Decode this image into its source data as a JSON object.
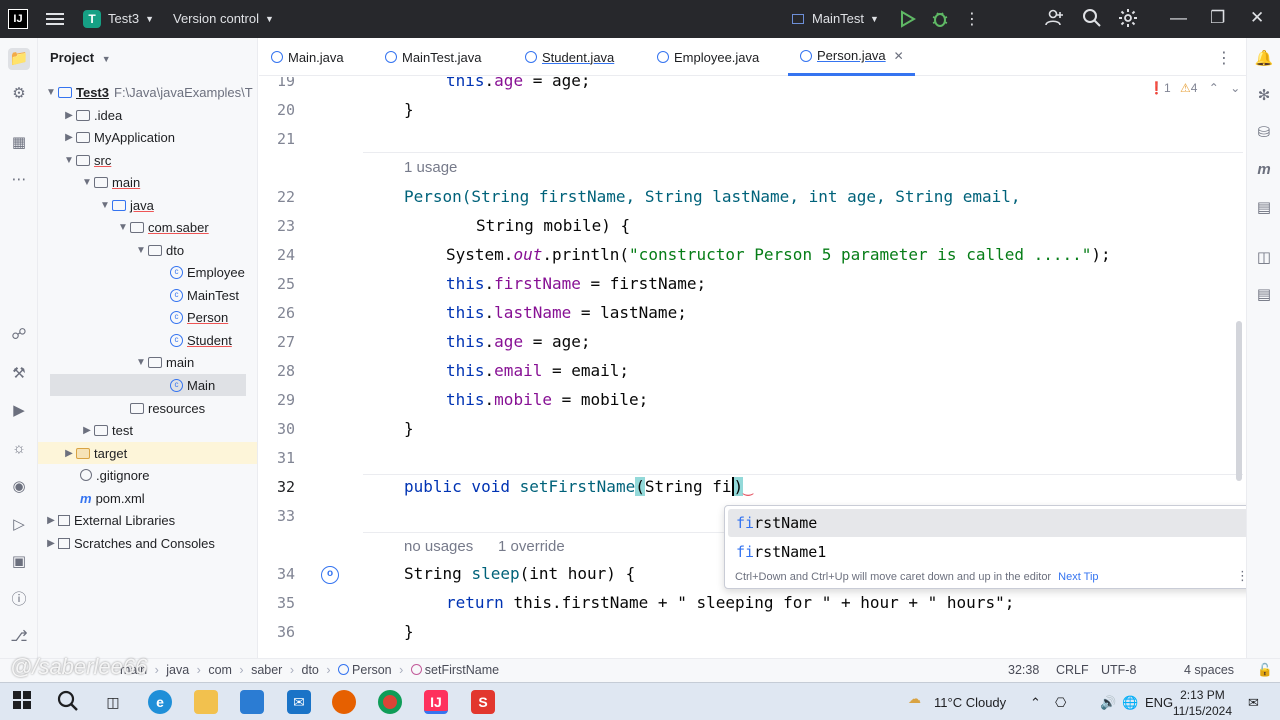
{
  "titlebar": {
    "project_badge": "T",
    "project_name": "Test3",
    "version_control": "Version control",
    "run_config": "MainTest"
  },
  "project_panel": {
    "title": "Project",
    "tree": [
      {
        "label": "Test3",
        "path": "F:\\Java\\javaExamples\\T",
        "type": "module"
      },
      {
        "label": ".idea",
        "type": "folder"
      },
      {
        "label": "MyApplication",
        "type": "folder"
      },
      {
        "label": "src",
        "type": "folder"
      },
      {
        "label": "main",
        "type": "folder"
      },
      {
        "label": "java",
        "type": "folder"
      },
      {
        "label": "com.saber",
        "type": "package"
      },
      {
        "label": "dto",
        "type": "package"
      },
      {
        "label": "Employee",
        "type": "class"
      },
      {
        "label": "MainTest",
        "type": "class"
      },
      {
        "label": "Person",
        "type": "class"
      },
      {
        "label": "Student",
        "type": "class"
      },
      {
        "label": "main",
        "type": "package"
      },
      {
        "label": "Main",
        "type": "class"
      },
      {
        "label": "resources",
        "type": "folder"
      },
      {
        "label": "test",
        "type": "folder"
      },
      {
        "label": "target",
        "type": "folder"
      },
      {
        "label": ".gitignore",
        "type": "file"
      },
      {
        "label": "pom.xml",
        "type": "maven"
      },
      {
        "label": "External Libraries",
        "type": "lib"
      },
      {
        "label": "Scratches and Consoles",
        "type": "scratch"
      }
    ]
  },
  "tabs": [
    {
      "label": "Main.java"
    },
    {
      "label": "MainTest.java"
    },
    {
      "label": "Student.java"
    },
    {
      "label": "Employee.java"
    },
    {
      "label": "Person.java",
      "active": true
    }
  ],
  "editor": {
    "inspection": {
      "errors": "1",
      "warnings": "4"
    },
    "line_numbers": [
      "19",
      "20",
      "21",
      "22",
      "23",
      "24",
      "25",
      "26",
      "27",
      "28",
      "29",
      "30",
      "31",
      "32",
      "33",
      "34",
      "35",
      "36"
    ],
    "usage_hint_1": "1 usage",
    "usage_hint_2": "no usages",
    "override_hint": "1 override",
    "lines": {
      "l19": "this.age = age;",
      "l20": "}",
      "l22a": "Person(String firstName, String lastName, int age, String email,",
      "l23": "String mobile) {",
      "l24a": "System.",
      "l24b": "out",
      "l24c": ".println(",
      "l24d": "\"constructor Person 5 parameter is called .....\"",
      "l24e": ");",
      "l25": "this.firstName = firstName;",
      "l26": "this.lastName = lastName;",
      "l27": "this.age = age;",
      "l28": "this.email = email;",
      "l29": "this.mobile = mobile;",
      "l30": "}",
      "l32a": "public void",
      "l32b": "setFirstName",
      "l32c": "(",
      "l32d": "String fi",
      "l32e": ")",
      "l34a": "String",
      "l34b": "sleep",
      "l34c": "(int hour) {",
      "l35a": "return",
      "l35b": "this.firstName + \" sleeping for \" + hour + \" hours\";",
      "l36": "}"
    }
  },
  "completion": {
    "items": [
      {
        "match": "fi",
        "rest": "rstName"
      },
      {
        "match": "fi",
        "rest": "rstName1"
      }
    ],
    "tip": "Ctrl+Down and Ctrl+Up will move caret down and up in the editor",
    "next_tip": "Next Tip"
  },
  "statusbar": {
    "breadcrumbs": [
      "main",
      "java",
      "com",
      "saber",
      "dto",
      "Person",
      "setFirstName"
    ],
    "position": "32:38",
    "line_sep": "CRLF",
    "encoding": "UTF-8",
    "indent": "4 spaces"
  },
  "taskbar": {
    "weather": "11°C  Cloudy",
    "lang": "ENG",
    "time": "2:13 PM",
    "date": "11/15/2024"
  },
  "watermark": "@/saberlee66"
}
